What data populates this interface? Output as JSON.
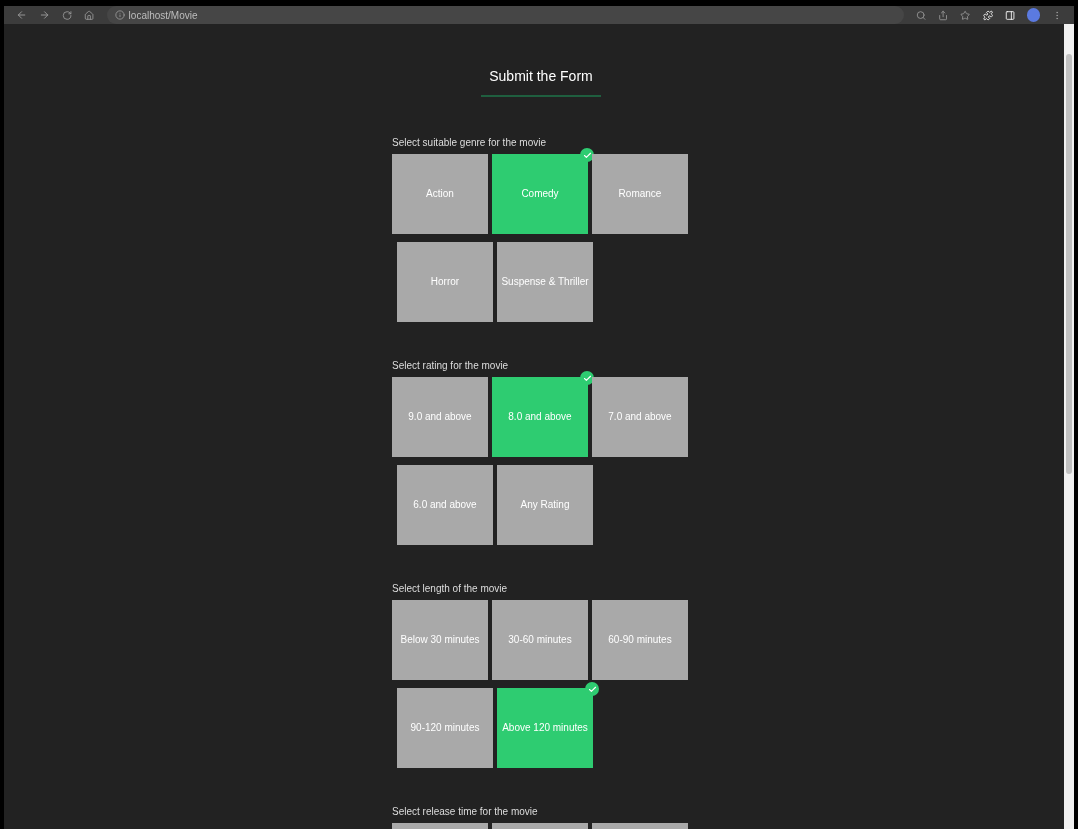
{
  "browser": {
    "url": "localhost/Movie"
  },
  "title": "Submit the Form",
  "sections": [
    {
      "label": "Select suitable genre for the movie",
      "options": [
        {
          "label": "Action",
          "selected": false
        },
        {
          "label": "Comedy",
          "selected": true
        },
        {
          "label": "Romance",
          "selected": false
        },
        {
          "label": "Horror",
          "selected": false
        },
        {
          "label": "Suspense & Thriller",
          "selected": false
        }
      ]
    },
    {
      "label": "Select rating for the movie",
      "options": [
        {
          "label": "9.0 and above",
          "selected": false
        },
        {
          "label": "8.0 and above",
          "selected": true
        },
        {
          "label": "7.0 and above",
          "selected": false
        },
        {
          "label": "6.0 and above",
          "selected": false
        },
        {
          "label": "Any Rating",
          "selected": false
        }
      ]
    },
    {
      "label": "Select length of the movie",
      "options": [
        {
          "label": "Below 30 minutes",
          "selected": false
        },
        {
          "label": "30-60 minutes",
          "selected": false
        },
        {
          "label": "60-90 minutes",
          "selected": false
        },
        {
          "label": "90-120 minutes",
          "selected": false
        },
        {
          "label": "Above 120 minutes",
          "selected": true
        }
      ]
    },
    {
      "label": "Select release time for the movie",
      "options": [
        {
          "selected": false
        },
        {
          "selected": false
        },
        {
          "selected": false
        }
      ]
    }
  ]
}
